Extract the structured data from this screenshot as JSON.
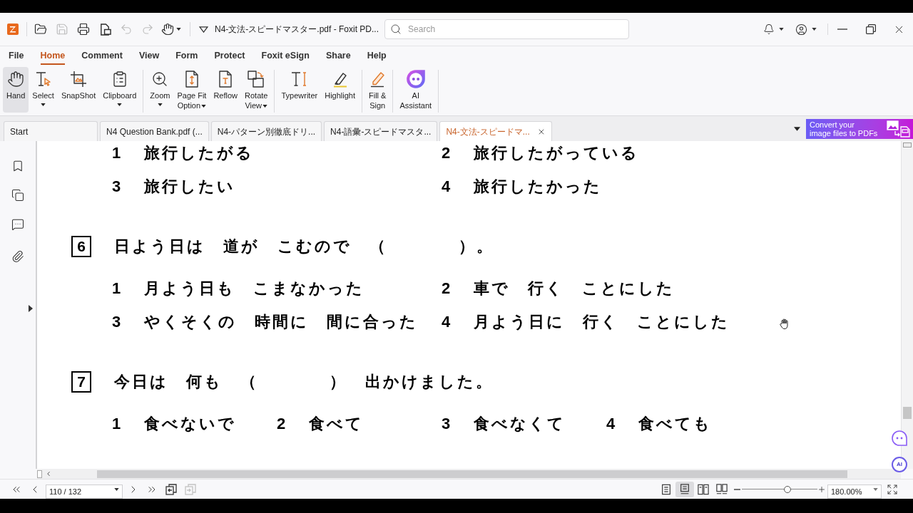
{
  "title_bar": {
    "quick_access": [
      {
        "kind": "open",
        "disabled": false
      },
      {
        "kind": "save",
        "disabled": true
      },
      {
        "kind": "print",
        "disabled": false
      },
      {
        "kind": "document",
        "disabled": false
      },
      {
        "kind": "undo",
        "disabled": true
      },
      {
        "kind": "redo",
        "disabled": true
      },
      {
        "kind": "hand",
        "disabled": false
      }
    ],
    "title": "N4-文法-スピードマスター.pdf - Foxit PD...",
    "search": {
      "placeholder": "Search"
    }
  },
  "menu_tabs": [
    {
      "label": "File",
      "selected": false
    },
    {
      "label": "Home",
      "selected": true
    },
    {
      "label": "Comment",
      "selected": false
    },
    {
      "label": "View",
      "selected": false
    },
    {
      "label": "Form",
      "selected": false
    },
    {
      "label": "Protect",
      "selected": false
    },
    {
      "label": "Foxit eSign",
      "selected": false
    },
    {
      "label": "Share",
      "selected": false
    },
    {
      "label": "Help",
      "selected": false
    }
  ],
  "ribbon": {
    "groups": [
      [
        {
          "kind": "hand",
          "label": "Hand",
          "selected": true,
          "dropdown": false
        },
        {
          "kind": "select",
          "label": "Select",
          "selected": false,
          "dropdown": true
        },
        {
          "kind": "snapshot",
          "label": "SnapShot",
          "selected": false,
          "dropdown": false
        },
        {
          "kind": "clipboard",
          "label": "Clipboard",
          "selected": false,
          "dropdown": true
        }
      ],
      [
        {
          "kind": "zoom",
          "label": "Zoom",
          "selected": false,
          "dropdown": true
        },
        {
          "kind": "page-fit",
          "label": "Page Fit\nOption",
          "selected": false,
          "dropdown": true
        },
        {
          "kind": "reflow",
          "label": "Reflow",
          "selected": false,
          "dropdown": false
        },
        {
          "kind": "rotate",
          "label": "Rotate\nView",
          "selected": false,
          "dropdown": true
        }
      ],
      [
        {
          "kind": "typewriter",
          "label": "Typewriter",
          "selected": false,
          "dropdown": false
        },
        {
          "kind": "highlight",
          "label": "Highlight",
          "selected": false,
          "dropdown": false
        }
      ],
      [
        {
          "kind": "fill-sign",
          "label": "Fill &\nSign",
          "selected": false,
          "dropdown": false
        }
      ],
      [
        {
          "kind": "ai",
          "label": "AI\nAssistant",
          "selected": false,
          "dropdown": false
        }
      ]
    ]
  },
  "doc_tabs": [
    {
      "label": "Start",
      "selected": false
    },
    {
      "label": "N4 Question Bank.pdf (...",
      "selected": false
    },
    {
      "label": "N4-パターン別徹底ドリ...",
      "selected": false
    },
    {
      "label": "N4-語彙-スピードマスタ...",
      "selected": false
    },
    {
      "label": "N4-文法-スピードマ...",
      "selected": true
    }
  ],
  "promo": {
    "lines": [
      "Convert your",
      "image files to PDFs"
    ]
  },
  "document": {
    "blocks": [
      {
        "choices": [
          [
            {
              "number": "1",
              "text": "旅行したがる"
            },
            {
              "number": "2",
              "text": "旅行したがっている"
            }
          ],
          [
            {
              "number": "3",
              "text": "旅行したい"
            },
            {
              "number": "4",
              "text": "旅行したかった"
            }
          ]
        ]
      },
      {
        "number": "6",
        "prompt": "日よう日は　道が　こむので　（　　　　）。",
        "choices": [
          [
            {
              "number": "1",
              "text": "月よう日も　こまなかった"
            },
            {
              "number": "2",
              "text": "車で　行く　ことにした"
            }
          ],
          [
            {
              "number": "3",
              "text": "やくそくの　時間に　間に合った"
            },
            {
              "number": "4",
              "text": "月よう日に　行く　ことにした"
            }
          ]
        ]
      },
      {
        "number": "7",
        "prompt": "今日は　何も　（　　　　）　出かけました。",
        "choices": [
          [
            {
              "number": "1",
              "text": "食べないで"
            },
            {
              "number": "2",
              "text": "食べて"
            },
            {
              "number": "3",
              "text": "食べなくて"
            },
            {
              "number": "4",
              "text": "食べても"
            }
          ]
        ]
      }
    ]
  },
  "side_buttons": [
    {
      "kind": "chat"
    },
    {
      "kind": "headset",
      "label": "AI"
    }
  ],
  "status_bar": {
    "page_field": {
      "value": "110 / 132"
    },
    "view_history": [
      {
        "disabled": false
      },
      {
        "disabled": true
      }
    ],
    "view_modes": [
      {
        "selected": false
      },
      {
        "selected": true
      },
      {
        "selected": false
      },
      {
        "selected": false
      }
    ],
    "zoom": {
      "level": 0.6,
      "value": "180.00%"
    }
  }
}
